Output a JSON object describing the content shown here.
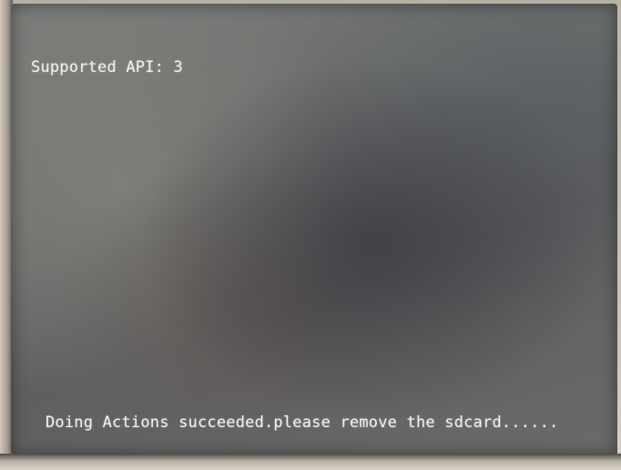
{
  "screen": {
    "lines": [
      "Supported API: 3",
      "Doing Actions succeeded.please remove the sdcard......"
    ]
  },
  "colors": {
    "text": "#f2f2ee",
    "screen": "#6f706e"
  }
}
